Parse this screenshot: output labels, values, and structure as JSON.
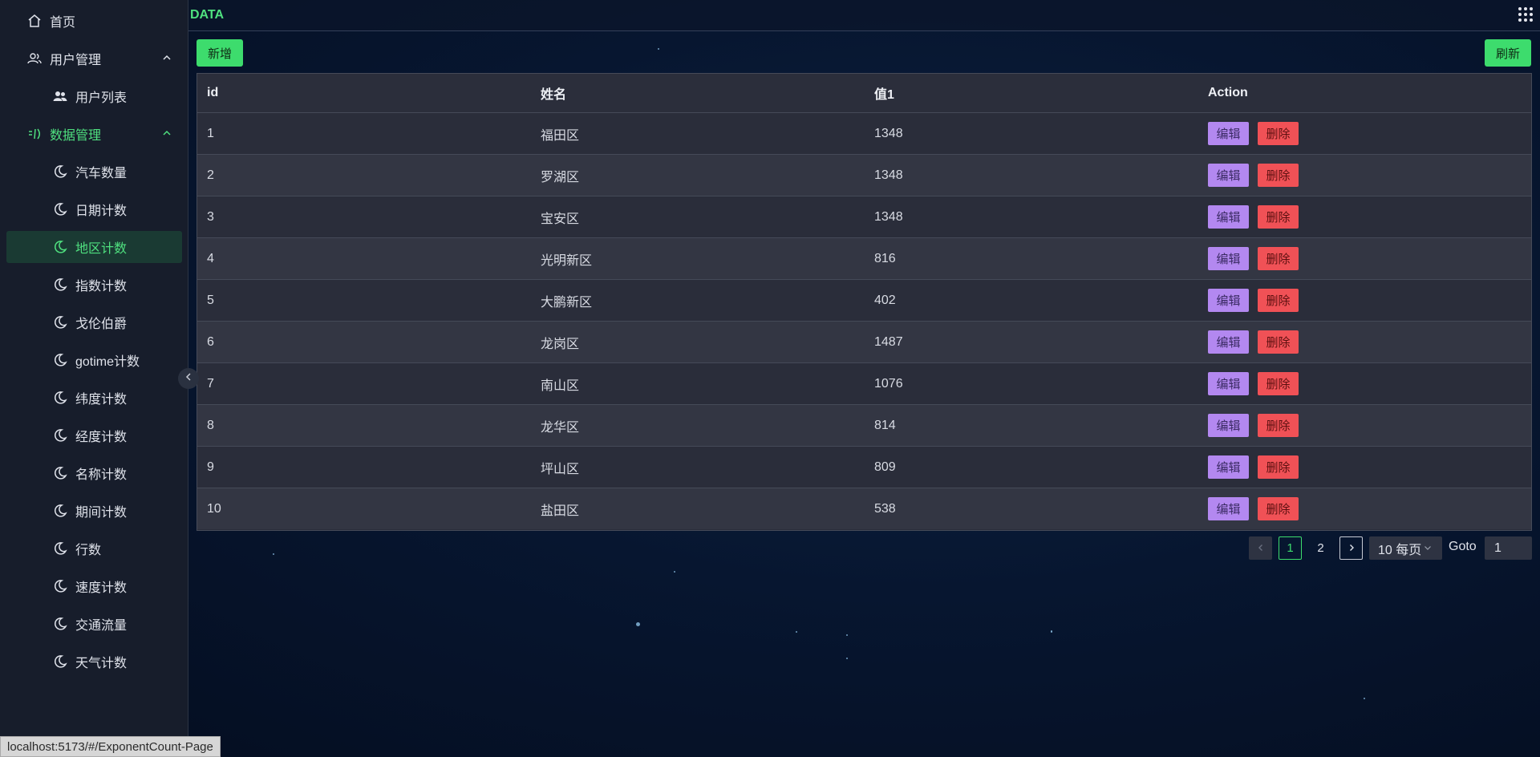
{
  "app": {
    "title": "DATA"
  },
  "sidebar": {
    "home": "首页",
    "user_group": "用户管理",
    "user_list": "用户列表",
    "data_group": "数据管理",
    "data_items": [
      {
        "label": "汽车数量"
      },
      {
        "label": "日期计数"
      },
      {
        "label": "地区计数",
        "active": true
      },
      {
        "label": "指数计数"
      },
      {
        "label": "戈伦伯爵"
      },
      {
        "label": "gotime计数"
      },
      {
        "label": "纬度计数"
      },
      {
        "label": "经度计数"
      },
      {
        "label": "名称计数"
      },
      {
        "label": "期间计数"
      },
      {
        "label": "行数"
      },
      {
        "label": "速度计数"
      },
      {
        "label": "交通流量"
      },
      {
        "label": "天气计数"
      }
    ]
  },
  "toolbar": {
    "add_label": "新增",
    "refresh_label": "刷新"
  },
  "table": {
    "headers": [
      "id",
      "姓名",
      "值1",
      "Action"
    ],
    "rows": [
      {
        "id": "1",
        "name": "福田区",
        "value": "1348"
      },
      {
        "id": "2",
        "name": "罗湖区",
        "value": "1348"
      },
      {
        "id": "3",
        "name": "宝安区",
        "value": "1348"
      },
      {
        "id": "4",
        "name": "光明新区",
        "value": "816"
      },
      {
        "id": "5",
        "name": "大鹏新区",
        "value": "402"
      },
      {
        "id": "6",
        "name": "龙岗区",
        "value": "1487"
      },
      {
        "id": "7",
        "name": "南山区",
        "value": "1076"
      },
      {
        "id": "8",
        "name": "龙华区",
        "value": "814"
      },
      {
        "id": "9",
        "name": "坪山区",
        "value": "809"
      },
      {
        "id": "10",
        "name": "盐田区",
        "value": "538"
      }
    ],
    "edit_label": "编辑",
    "delete_label": "删除"
  },
  "pagination": {
    "pages": [
      "1",
      "2"
    ],
    "current": "1",
    "page_size_label": "10 每页",
    "goto_label": "Goto",
    "goto_value": "1"
  },
  "status_bar": {
    "url": "localhost:5173/#/ExponentCount-Page"
  },
  "colors": {
    "accent": "#3ddc6d",
    "edit": "#b388f0",
    "delete": "#f05156"
  }
}
